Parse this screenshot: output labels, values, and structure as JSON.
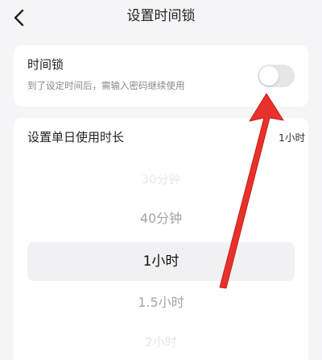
{
  "header": {
    "title": "设置时间锁",
    "back_icon": "chevron-left-icon"
  },
  "lock_card": {
    "title": "时间锁",
    "description": "到了设定时间后，需输入密码继续使用",
    "toggle_on": false
  },
  "duration_card": {
    "label": "设置单日使用时长",
    "selected_value": "1小时",
    "options": [
      "30分钟",
      "40分钟",
      "1小时",
      "1.5小时",
      "2小时"
    ],
    "selected_index": 2
  },
  "annotation": {
    "icon": "red-arrow-icon",
    "color": "#e8312b"
  },
  "colors": {
    "background": "#f5f5f7",
    "card": "#ffffff",
    "toggle_off": "#e6e6e8"
  }
}
